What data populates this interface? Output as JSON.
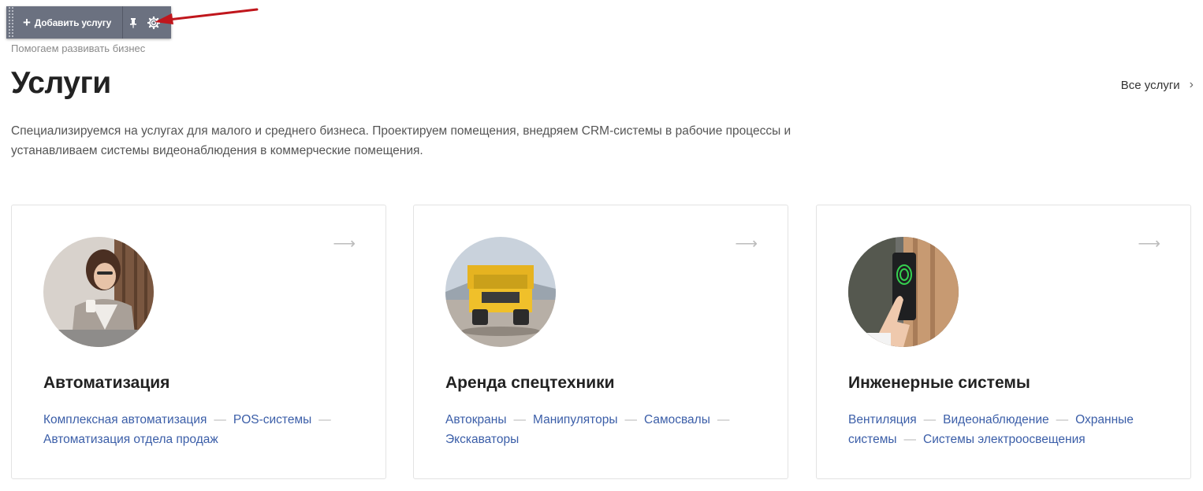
{
  "toolbar": {
    "add_label": "Добавить услугу",
    "add_icon": "plus-icon",
    "pin_icon": "pin-icon",
    "settings_icon": "gear-icon"
  },
  "header": {
    "subtitle": "Помогаем развивать бизнес",
    "title": "Услуги",
    "all_link": "Все услуги",
    "description": "Специализируемся на услугах для малого и среднего бизнеса. Проектируем помещения, внедряем CRM-системы в рабочие процессы и устанавливаем системы видеонаблюдения в коммерческие помещения."
  },
  "cards": [
    {
      "title": "Автоматизация",
      "image": "woman-with-coffee-photo",
      "links": [
        "Комплексная автоматизация",
        "POS-системы",
        "Автоматизация отдела продаж"
      ]
    },
    {
      "title": "Аренда спецтехники",
      "image": "yellow-dump-truck-photo",
      "links": [
        "Автокраны",
        "Манипуляторы",
        "Самосвалы",
        "Экскаваторы"
      ]
    },
    {
      "title": "Инженерные системы",
      "image": "fingerprint-scanner-photo",
      "links": [
        "Вентиляция",
        "Видеонаблюдение",
        "Охранные системы",
        "Системы электроосвещения"
      ]
    }
  ],
  "colors": {
    "toolbar_bg": "#6b7180",
    "link": "#3b5ea8",
    "annotation_arrow": "#c0161c"
  }
}
